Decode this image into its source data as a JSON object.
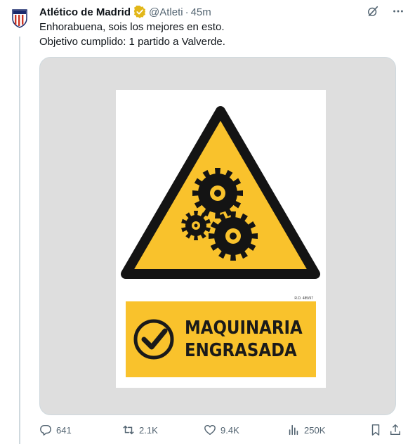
{
  "tweet": {
    "author_name": "Atlético de Madrid",
    "handle": "@Atleti",
    "separator": "·",
    "time": "45m",
    "lines": [
      "Enhorabuena, sois los mejores en esto.",
      "Objetivo cumplido: 1 partido a Valverde."
    ]
  },
  "sign": {
    "small_text": "R.D. 485/97",
    "panel_lines": [
      "MAQUINARIA",
      "ENGRASADA"
    ]
  },
  "metrics": {
    "replies": "641",
    "reposts": "2.1K",
    "likes": "9.4K",
    "views": "250K"
  },
  "colors": {
    "sign_yellow": "#f9c22c",
    "verified_gold": "#e2b719",
    "muted_text": "#536471"
  },
  "icons": {
    "verified": "verified-badge-icon",
    "grok": "grok-icon",
    "more": "more-icon",
    "reply": "reply-icon",
    "repost": "repost-icon",
    "like": "heart-icon",
    "views": "views-icon",
    "bookmark": "bookmark-icon",
    "share": "share-icon"
  }
}
